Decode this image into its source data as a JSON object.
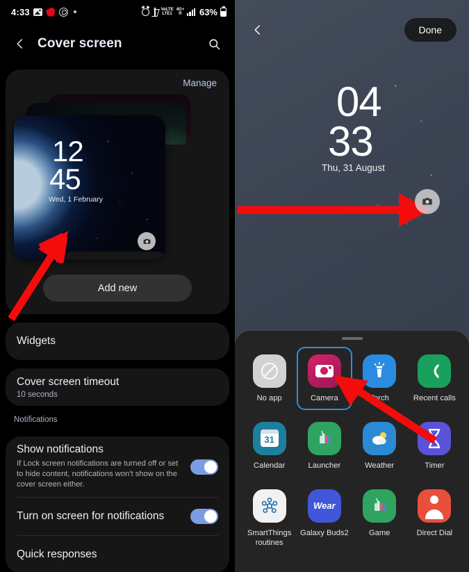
{
  "left": {
    "statusbar": {
      "time": "4:33",
      "battery_percent": "63%",
      "icons": [
        "gallery-icon",
        "airtel-icon",
        "whatsapp-icon",
        "dot-icon",
        "alarm-icon",
        "bluetooth-icon",
        "volte-icon",
        "network-4g-plus-icon",
        "signal-bars-icon",
        "battery-icon"
      ],
      "volte_line1": "VoLTE",
      "volte_line2": "LTE1",
      "net_line1": "4G+",
      "net_line2": "R"
    },
    "appbar": {
      "back_icon": "back-chevron-icon",
      "title": "Cover screen",
      "search_icon": "search-icon"
    },
    "preview": {
      "manage_label": "Manage",
      "clock_hours": "12",
      "clock_minutes": "45",
      "date": "Wed, 1 February",
      "shortcut_icon": "camera-shortcut-icon",
      "add_new_label": "Add new"
    },
    "settings": [
      {
        "title": "Widgets",
        "sub": ""
      },
      {
        "title": "Cover screen timeout",
        "sub": "10 seconds"
      }
    ],
    "notifications_label": "Notifications",
    "notification_rows": [
      {
        "title": "Show notifications",
        "desc": "If Lock screen notifications are turned off or set to hide content, notifications won't show on the cover screen either.",
        "toggle": "on"
      },
      {
        "title": "Turn on screen for notifications",
        "desc": "",
        "toggle": "on"
      },
      {
        "title": "Quick responses",
        "desc": "",
        "toggle": ""
      }
    ]
  },
  "right": {
    "appbar": {
      "back_icon": "back-chevron-icon",
      "done_label": "Done"
    },
    "preview": {
      "clock_hours": "04",
      "clock_minutes": "33",
      "date": "Thu, 31 August",
      "shortcut_icon": "camera-shortcut-icon"
    },
    "sheet": {
      "handle_icon": "drag-handle-icon",
      "apps": [
        {
          "label": "No app",
          "icon": "no-app-icon",
          "selected": false
        },
        {
          "label": "Camera",
          "icon": "camera-app-icon",
          "selected": true
        },
        {
          "label": "Torch",
          "icon": "torch-app-icon",
          "selected": false
        },
        {
          "label": "Recent calls",
          "icon": "recent-calls-app-icon",
          "selected": false
        },
        {
          "label": "Calendar",
          "icon": "calendar-app-icon",
          "selected": false
        },
        {
          "label": "Launcher",
          "icon": "launcher-app-icon",
          "selected": false
        },
        {
          "label": "Weather",
          "icon": "weather-app-icon",
          "selected": false
        },
        {
          "label": "Timer",
          "icon": "timer-app-icon",
          "selected": false
        },
        {
          "label": "SmartThings routines",
          "icon": "smartthings-app-icon",
          "selected": false
        },
        {
          "label": "Galaxy Buds2",
          "icon": "galaxy-buds-app-icon",
          "selected": false
        },
        {
          "label": "Game",
          "icon": "game-app-icon",
          "selected": false
        },
        {
          "label": "Direct Dial",
          "icon": "direct-dial-app-icon",
          "selected": false
        }
      ],
      "calendar_day": "31",
      "buds_text": "Wear"
    }
  },
  "annotations": {
    "arrow_color": "#f40c0c",
    "selection_color": "#2e8fe0"
  }
}
